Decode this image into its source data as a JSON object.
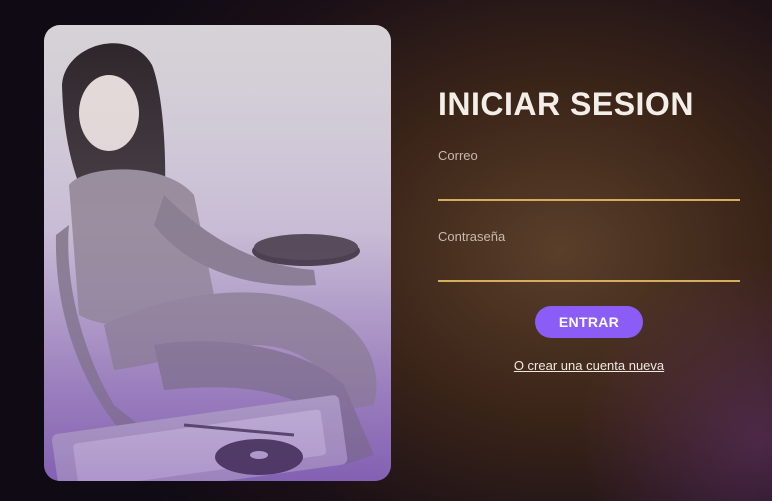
{
  "photo": {
    "alt": ""
  },
  "login": {
    "title": "INICIAR SESION",
    "email_label": "Correo",
    "email_value": "",
    "password_label": "Contraseña",
    "password_value": "",
    "submit_label": "ENTRAR",
    "register_link": "O crear una cuenta nueva"
  },
  "colors": {
    "accent_button": "#8b5cf6",
    "input_underline": "#d6ad5e",
    "background_dark": "#0f0a14"
  }
}
